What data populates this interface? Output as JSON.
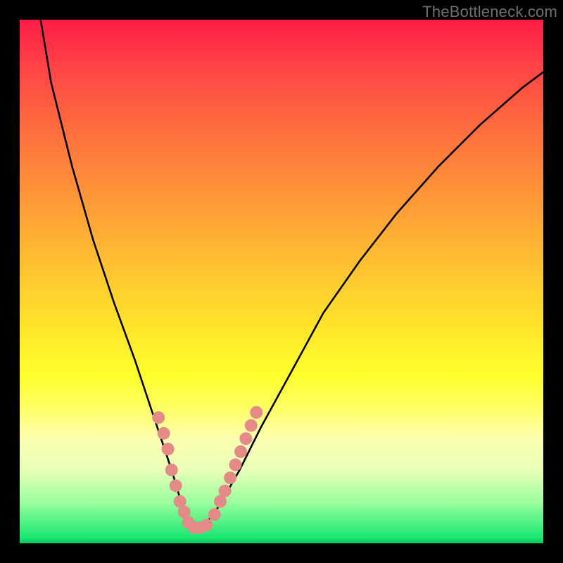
{
  "watermark": "TheBottleneck.com",
  "chart_data": {
    "type": "line",
    "title": "",
    "xlabel": "",
    "ylabel": "",
    "xlim": [
      0,
      100
    ],
    "ylim": [
      0,
      100
    ],
    "series": [
      {
        "name": "curve",
        "x": [
          3,
          6,
          10,
          14,
          18,
          22,
          25,
          27,
          29,
          30.5,
          32,
          33.5,
          35,
          38,
          42,
          46,
          52,
          58,
          65,
          72,
          80,
          88,
          96,
          100
        ],
        "y": [
          106,
          88,
          72,
          58,
          46,
          35,
          26,
          20,
          14,
          9,
          5,
          3,
          3,
          7,
          14,
          22,
          33,
          44,
          54,
          63,
          72,
          80,
          87,
          90
        ]
      }
    ],
    "markers": {
      "name": "highlight-dots",
      "color": "#e58b87",
      "points": [
        {
          "x": 26.5,
          "y": 24
        },
        {
          "x": 27.5,
          "y": 21
        },
        {
          "x": 28.3,
          "y": 18
        },
        {
          "x": 29.0,
          "y": 14
        },
        {
          "x": 29.8,
          "y": 11
        },
        {
          "x": 30.6,
          "y": 8
        },
        {
          "x": 31.4,
          "y": 6
        },
        {
          "x": 32.2,
          "y": 4
        },
        {
          "x": 33.3,
          "y": 3
        },
        {
          "x": 34.5,
          "y": 3
        },
        {
          "x": 35.7,
          "y": 3.5
        },
        {
          "x": 37.2,
          "y": 5.5
        },
        {
          "x": 38.3,
          "y": 8
        },
        {
          "x": 39.2,
          "y": 10
        },
        {
          "x": 40.2,
          "y": 12.5
        },
        {
          "x": 41.2,
          "y": 15
        },
        {
          "x": 42.2,
          "y": 17.5
        },
        {
          "x": 43.2,
          "y": 20
        },
        {
          "x": 44.2,
          "y": 22.5
        },
        {
          "x": 45.2,
          "y": 25
        }
      ]
    }
  }
}
